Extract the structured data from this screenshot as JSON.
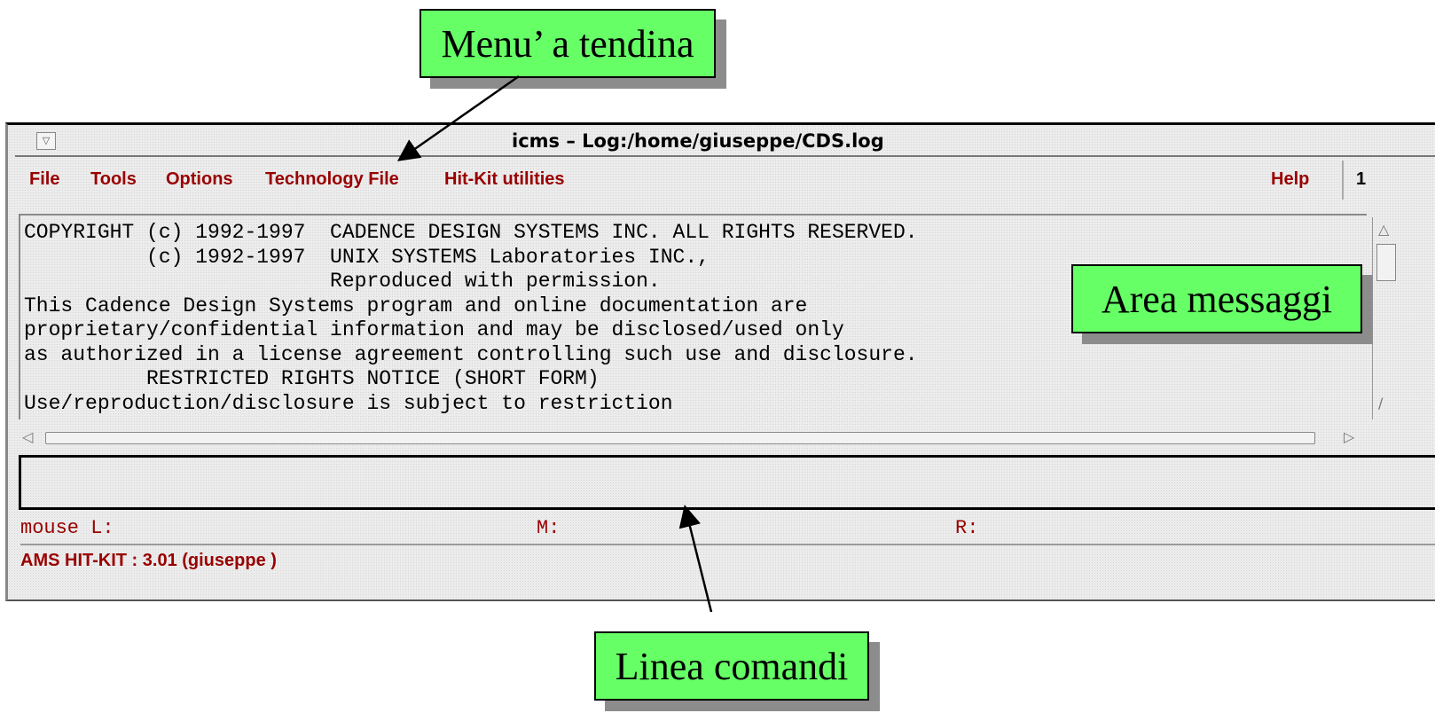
{
  "callouts": {
    "menu": "Menu’ a tendina",
    "messages": "Area messaggi",
    "command": "Linea comandi"
  },
  "window": {
    "menu_button_icon": "▽",
    "title": "icms – Log:/home/giuseppe/CDS.log"
  },
  "menubar": {
    "items": [
      "File",
      "Tools",
      "Options",
      "Technology File",
      "Hit-Kit utilities"
    ],
    "help": "Help",
    "number": "1"
  },
  "message_area": {
    "lines": [
      "COPYRIGHT (c) 1992-1997  CADENCE DESIGN SYSTEMS INC. ALL RIGHTS RESERVED.",
      "          (c) 1992-1997  UNIX SYSTEMS Laboratories INC.,",
      "                         Reproduced with permission.",
      "This Cadence Design Systems program and online documentation are",
      "proprietary/confidential information and may be disclosed/used only",
      "as authorized in a license agreement controlling such use and disclosure.",
      "          RESTRICTED RIGHTS NOTICE (SHORT FORM)",
      "Use/reproduction/disclosure is subject to restriction"
    ]
  },
  "command_line": {
    "value": ""
  },
  "mouse": {
    "left": "mouse L:",
    "middle": "M:",
    "right": "R:"
  },
  "status": {
    "text": "AMS HIT-KIT : 3.01  (giuseppe )"
  },
  "colors": {
    "callout_bg": "#66ff66",
    "menu_text": "#990000",
    "window_bg": "#ececec"
  }
}
